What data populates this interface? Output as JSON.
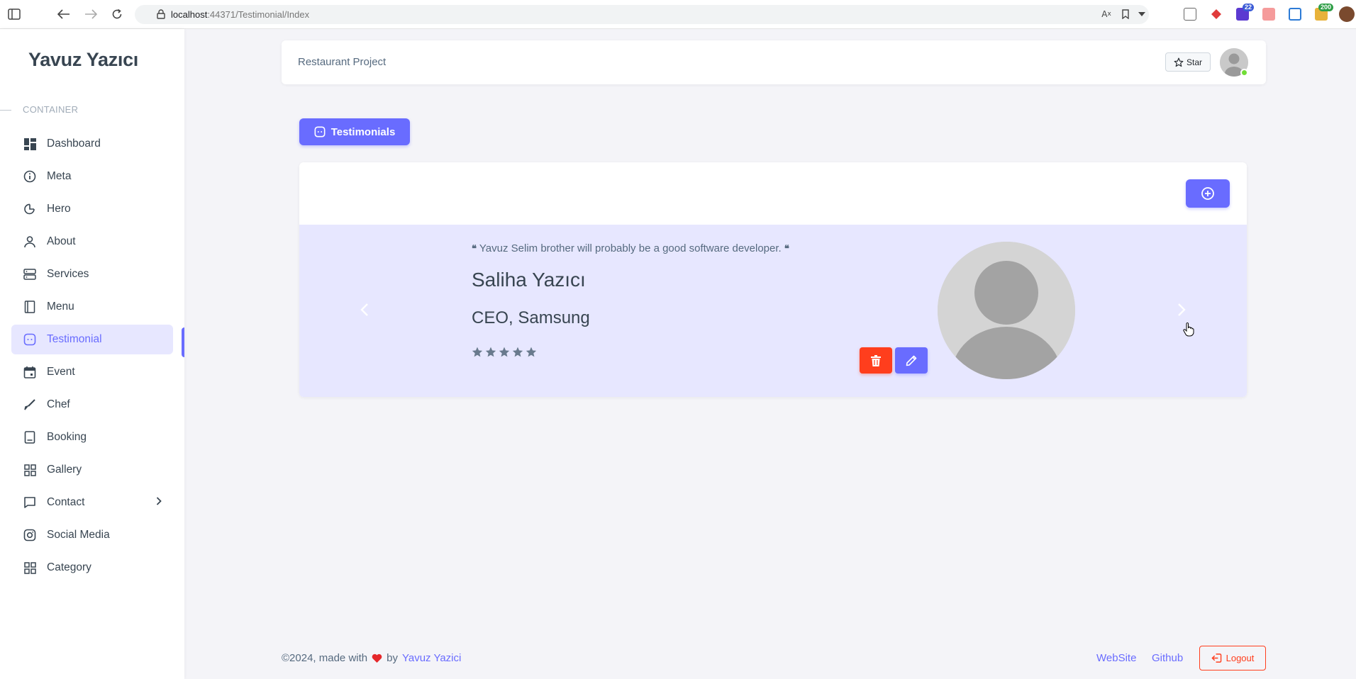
{
  "browser": {
    "url_host": "localhost",
    "url_path": ":44371/Testimonial/Index",
    "extension_badges": [
      "22",
      "200"
    ]
  },
  "sidebar": {
    "brand": "Yavuz Yazıcı",
    "section_header": "CONTAINER",
    "items": [
      {
        "label": "Dashboard",
        "icon": "dashboard-icon"
      },
      {
        "label": "Meta",
        "icon": "info-icon"
      },
      {
        "label": "Hero",
        "icon": "pie-chart-icon"
      },
      {
        "label": "About",
        "icon": "user-icon"
      },
      {
        "label": "Services",
        "icon": "server-icon"
      },
      {
        "label": "Menu",
        "icon": "book-icon"
      },
      {
        "label": "Testimonial",
        "icon": "message-icon",
        "active": true
      },
      {
        "label": "Event",
        "icon": "calendar-icon"
      },
      {
        "label": "Chef",
        "icon": "brush-icon"
      },
      {
        "label": "Booking",
        "icon": "receipt-icon"
      },
      {
        "label": "Gallery",
        "icon": "grid-icon"
      },
      {
        "label": "Contact",
        "icon": "chat-icon",
        "has_submenu": true
      },
      {
        "label": "Social Media",
        "icon": "instagram-icon"
      },
      {
        "label": "Category",
        "icon": "grid-icon"
      }
    ]
  },
  "navbar": {
    "title": "Restaurant Project",
    "star_label": "Star"
  },
  "page": {
    "title_button": "Testimonials"
  },
  "testimonial": {
    "quote": "Yavuz Selim brother will probably be a good software developer.",
    "name": "Saliha Yazıcı",
    "position": "CEO, Samsung",
    "rating": 5
  },
  "footer": {
    "copyright": "©2024, made with",
    "by": "by",
    "author": "Yavuz Yazici",
    "website": "WebSite",
    "github": "Github",
    "logout": "Logout"
  },
  "colors": {
    "primary": "#696cff",
    "danger": "#ff3e1d",
    "active_bg": "#e7e7ff",
    "text": "#384551"
  }
}
